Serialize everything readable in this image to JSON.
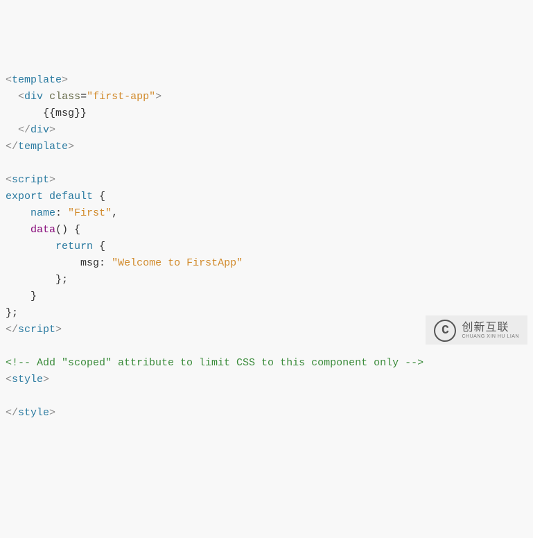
{
  "code": {
    "l1": {
      "ob": "<",
      "tag": "template",
      "cb": ">"
    },
    "l2": {
      "indent": "  ",
      "ob": "<",
      "tag": "div",
      "sp": " ",
      "attr": "class",
      "eq": "=",
      "str": "\"first-app\"",
      "cb": ">"
    },
    "l3": {
      "indent": "      ",
      "text": "{{msg}}"
    },
    "l4": {
      "indent": "  ",
      "ob": "</",
      "tag": "div",
      "cb": ">"
    },
    "l5": {
      "ob": "</",
      "tag": "template",
      "cb": ">"
    },
    "l6": "",
    "l7": {
      "ob": "<",
      "tag": "script",
      "cb": ">"
    },
    "l8": {
      "kw1": "export",
      "sp": " ",
      "kw2": "default",
      "rest": " {"
    },
    "l9": {
      "indent": "    ",
      "prop": "name",
      "colon": ": ",
      "str": "\"First\"",
      "comma": ","
    },
    "l10": {
      "indent": "    ",
      "func": "data",
      "rest": "() {"
    },
    "l11": {
      "indent": "        ",
      "kw": "return",
      "rest": " {"
    },
    "l12": {
      "indent": "            ",
      "prop": "msg",
      "colon": ": ",
      "str": "\"Welcome to FirstApp\""
    },
    "l13": {
      "indent": "        ",
      "text": "};"
    },
    "l14": {
      "indent": "    ",
      "text": "}"
    },
    "l15": {
      "text": "};"
    },
    "l16": {
      "ob": "</",
      "tag": "script",
      "cb": ">"
    },
    "l17": "",
    "l18": {
      "text": "<!-- Add \"scoped\" attribute to limit CSS to this component only -->"
    },
    "l19": {
      "ob": "<",
      "tag": "style",
      "cb": ">"
    },
    "l20": "",
    "l21": {
      "ob": "</",
      "tag": "style",
      "cb": ">"
    }
  },
  "watermark": {
    "logo_letter": "C",
    "main": "创新互联",
    "sub": "CHUANG XIN HU LIAN"
  }
}
